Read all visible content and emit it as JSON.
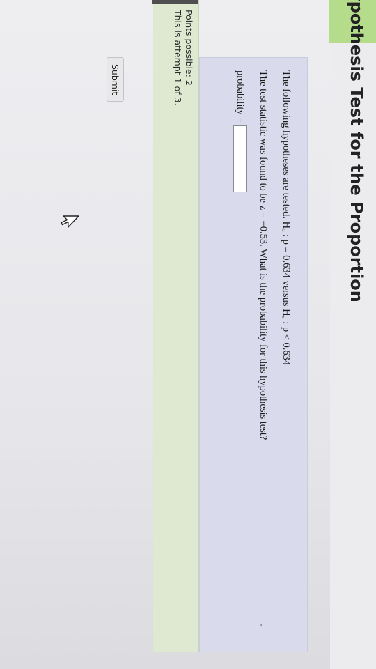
{
  "page": {
    "title": "ypothesis Test for the Proportion"
  },
  "question": {
    "line1": "The following hypotheses are tested. Hₒ : p = 0.634 versus Hₐ : p < 0.634",
    "line2": "The test statistic was found to be z = −0.53. What is the probability for this hypothesis test?",
    "probability_label": "probability =",
    "probability_value": "",
    "dot": "·"
  },
  "info": {
    "points": "Points possible: 2",
    "attempt": "This is attempt 1 of 3."
  },
  "actions": {
    "submit_label": "Submit"
  },
  "colors": {
    "accent_green": "#b4dc8a",
    "question_bg": "#d9dbec",
    "info_bg": "#dfe9d2"
  }
}
